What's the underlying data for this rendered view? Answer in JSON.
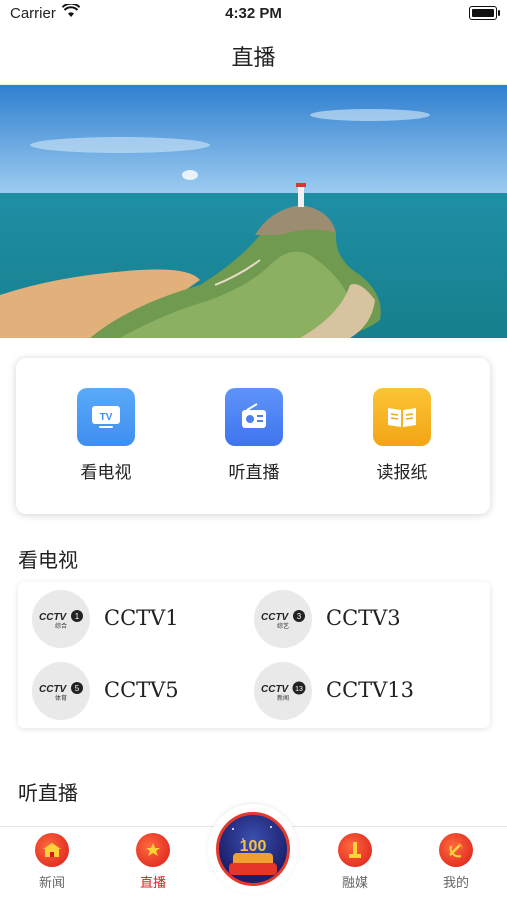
{
  "status_bar": {
    "carrier": "Carrier",
    "time": "4:32 PM"
  },
  "nav": {
    "title": "直播"
  },
  "quick_actions": [
    {
      "label": "看电视",
      "icon": "tv-icon",
      "color": "#4a9cf5"
    },
    {
      "label": "听直播",
      "icon": "radio-icon",
      "color": "#4f86f7"
    },
    {
      "label": "读报纸",
      "icon": "book-icon",
      "color": "#f7b21e"
    }
  ],
  "tv_section": {
    "title": "看电视",
    "channels": [
      {
        "name": "CCTV1",
        "badge": "1",
        "sub": "综合"
      },
      {
        "name": "CCTV3",
        "badge": "3",
        "sub": "综艺"
      },
      {
        "name": "CCTV5",
        "badge": "5",
        "sub": "体育"
      },
      {
        "name": "CCTV13",
        "badge": "13",
        "sub": "新闻"
      }
    ]
  },
  "radio_section": {
    "title": "听直播"
  },
  "tabbar": {
    "tabs": [
      {
        "label": "新闻",
        "active": false
      },
      {
        "label": "直播",
        "active": true
      },
      {
        "label": "融媒",
        "active": false
      },
      {
        "label": "我的",
        "active": false
      }
    ],
    "center_label": "100",
    "active_color": "#d81e1e"
  }
}
